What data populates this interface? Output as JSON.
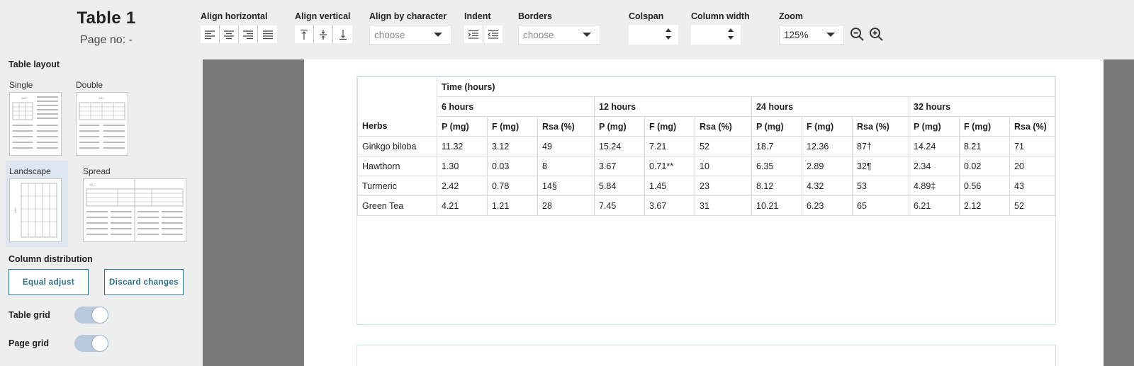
{
  "header": {
    "title": "Table 1",
    "page_no": "Page no: -"
  },
  "toolbar": {
    "align_horizontal": "Align horizontal",
    "align_vertical": "Align vertical",
    "align_by_character": "Align by character",
    "align_char_value": "choose",
    "indent": "Indent",
    "borders": "Borders",
    "borders_value": "choose",
    "colspan": "Colspan",
    "column_width": "Column width",
    "zoom": "Zoom",
    "zoom_value": "125%"
  },
  "sidebar": {
    "table_layout": "Table layout",
    "layouts": {
      "single": "Single",
      "double": "Double",
      "landscape": "Landscape",
      "spread": "Spread"
    },
    "thumb_text": "ABC",
    "column_distribution": "Column distribution",
    "equal_adjust": "Equal adjust",
    "discard_changes": "Discard changes",
    "table_grid": "Table grid",
    "page_grid": "Page grid",
    "selected_layout": "Landscape",
    "table_grid_on": true,
    "page_grid_on": true
  },
  "table": {
    "time_header": "Time (hours)",
    "groups": [
      "6 hours",
      "12 hours",
      "24 hours",
      "32 hours"
    ],
    "row_header": "Herbs",
    "sub_headers": [
      "P (mg)",
      "F (mg)",
      "Rsa (%)"
    ],
    "rows": [
      {
        "herb": "Ginkgo biloba",
        "cells": [
          "11.32",
          "3.12",
          "49",
          "15.24",
          "7.21",
          "52",
          "18.7",
          "12.36",
          "87†",
          "14.24",
          "8.21",
          "71"
        ]
      },
      {
        "herb": "Hawthorn",
        "cells": [
          "1.30",
          "0.03",
          "8",
          "3.67",
          "0.71**",
          "10",
          "6.35",
          "2.89",
          "32¶",
          "2.34",
          "0.02",
          "20"
        ]
      },
      {
        "herb": "Turmeric",
        "cells": [
          "2.42",
          "0.78",
          "14§",
          "5.84",
          "1.45",
          "23",
          "8.12",
          "4.32",
          "53",
          "4.89‡",
          "0.56",
          "43"
        ]
      },
      {
        "herb": "Green Tea",
        "cells": [
          "4.21",
          "1.21",
          "28",
          "7.45",
          "3.67",
          "31",
          "10.21",
          "6.23",
          "65",
          "6.21",
          "2.12",
          "52"
        ]
      }
    ]
  },
  "colors": {
    "accent": "#2b6f8e",
    "toggle": "#b9c8dc",
    "frame": "#c6ecf3",
    "canvas": "#7a7a7a"
  }
}
